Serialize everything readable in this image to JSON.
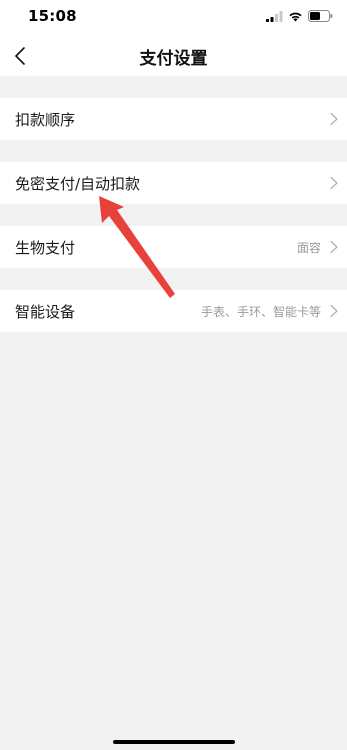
{
  "status_bar": {
    "time": "15:08",
    "icons": [
      "signal-icon",
      "wifi-icon",
      "battery-icon"
    ]
  },
  "header": {
    "back_icon": "chevron-left-icon",
    "title": "支付设置"
  },
  "settings": {
    "items": [
      {
        "label": "扣款顺序",
        "value": ""
      },
      {
        "label": "免密支付/自动扣款",
        "value": ""
      },
      {
        "label": "生物支付",
        "value": "面容"
      },
      {
        "label": "智能设备",
        "value": "手表、手环、智能卡等"
      }
    ]
  },
  "annotation": {
    "arrow_color": "#e8403a"
  },
  "colors": {
    "background": "#f2f2f2",
    "card": "#ffffff",
    "primary_text": "#1a1a1a",
    "secondary_text": "#9a9a9a",
    "chevron": "#b5b5b5"
  }
}
